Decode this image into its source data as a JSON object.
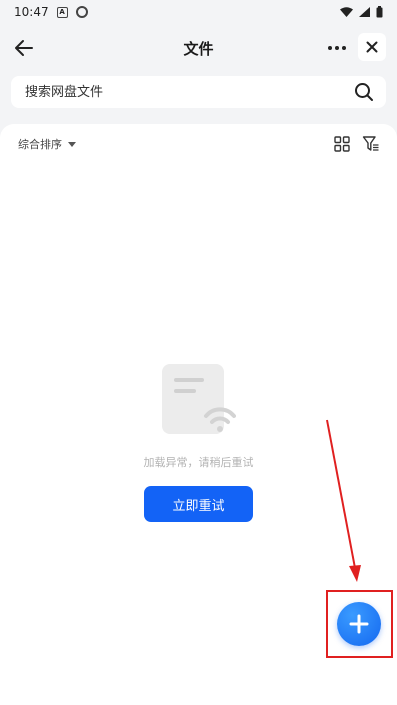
{
  "status_bar": {
    "time": "10:47",
    "badge_a": "A"
  },
  "header": {
    "title": "文件"
  },
  "search": {
    "placeholder": "搜索网盘文件"
  },
  "toolbar": {
    "sort_label": "综合排序"
  },
  "empty_state": {
    "message": "加载异常，请稍后重试",
    "retry_label": "立即重试"
  },
  "colors": {
    "accent": "#1363f6",
    "annotation": "#e02020"
  },
  "icons": [
    "back-arrow-icon",
    "more-icon",
    "close-icon",
    "search-icon",
    "sort-caret-icon",
    "grid-view-icon",
    "filter-icon",
    "document-wifi-icon",
    "plus-icon"
  ]
}
